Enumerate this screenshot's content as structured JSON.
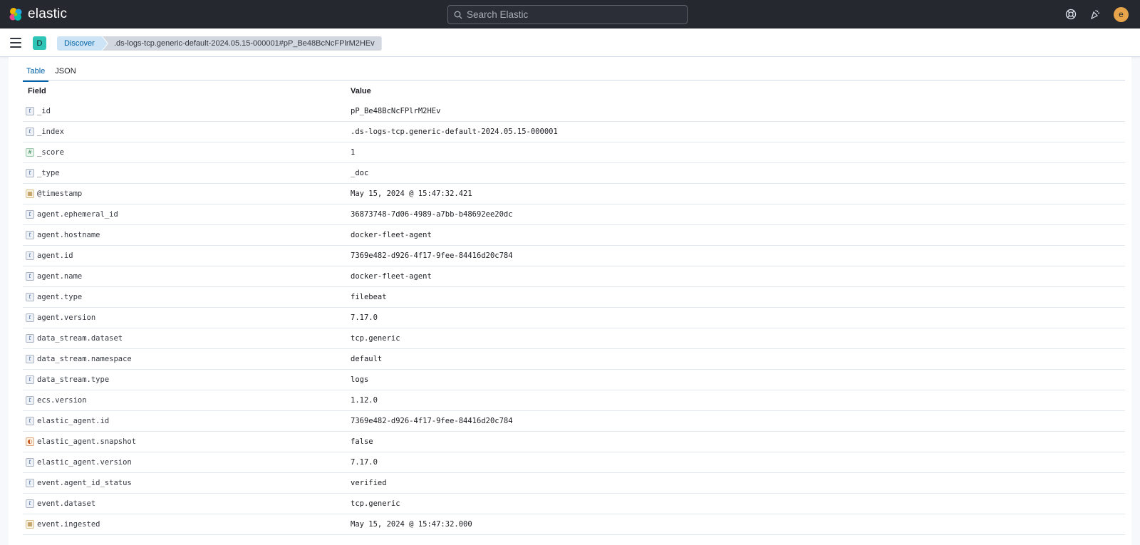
{
  "header": {
    "logo_text": "elastic",
    "search_placeholder": "Search Elastic",
    "avatar_letter": "e",
    "icons": [
      "help-icon",
      "newsfeed-icon"
    ]
  },
  "breadcrumb": {
    "space_badge": "D",
    "items": [
      "Discover",
      ".ds-logs-tcp.generic-default-2024.05.15-000001#pP_Be48BcNcFPlrM2HEv"
    ]
  },
  "tabs": [
    "Table",
    "JSON"
  ],
  "active_tab": "Table",
  "table": {
    "columns": [
      "Field",
      "Value"
    ],
    "rows": [
      {
        "type": "t",
        "field": "_id",
        "value": "pP_Be48BcNcFPlrM2HEv"
      },
      {
        "type": "t",
        "field": "_index",
        "value": ".ds-logs-tcp.generic-default-2024.05.15-000001"
      },
      {
        "type": "#",
        "field": "_score",
        "value": "1"
      },
      {
        "type": "t",
        "field": "_type",
        "value": "_doc"
      },
      {
        "type": "date",
        "field": "@timestamp",
        "value": "May 15, 2024 @ 15:47:32.421"
      },
      {
        "type": "t",
        "field": "agent.ephemeral_id",
        "value": "36873748-7d06-4989-a7bb-b48692ee20dc"
      },
      {
        "type": "t",
        "field": "agent.hostname",
        "value": "docker-fleet-agent"
      },
      {
        "type": "t",
        "field": "agent.id",
        "value": "7369e482-d926-4f17-9fee-84416d20c784"
      },
      {
        "type": "t",
        "field": "agent.name",
        "value": "docker-fleet-agent"
      },
      {
        "type": "t",
        "field": "agent.type",
        "value": "filebeat"
      },
      {
        "type": "t",
        "field": "agent.version",
        "value": "7.17.0"
      },
      {
        "type": "t",
        "field": "data_stream.dataset",
        "value": "tcp.generic"
      },
      {
        "type": "t",
        "field": "data_stream.namespace",
        "value": "default"
      },
      {
        "type": "t",
        "field": "data_stream.type",
        "value": "logs"
      },
      {
        "type": "t",
        "field": "ecs.version",
        "value": "1.12.0"
      },
      {
        "type": "t",
        "field": "elastic_agent.id",
        "value": "7369e482-d926-4f17-9fee-84416d20c784"
      },
      {
        "type": "bool",
        "field": "elastic_agent.snapshot",
        "value": "false"
      },
      {
        "type": "t",
        "field": "elastic_agent.version",
        "value": "7.17.0"
      },
      {
        "type": "t",
        "field": "event.agent_id_status",
        "value": "verified"
      },
      {
        "type": "t",
        "field": "event.dataset",
        "value": "tcp.generic"
      },
      {
        "type": "date",
        "field": "event.ingested",
        "value": "May 15, 2024 @ 15:47:32.000"
      }
    ]
  }
}
